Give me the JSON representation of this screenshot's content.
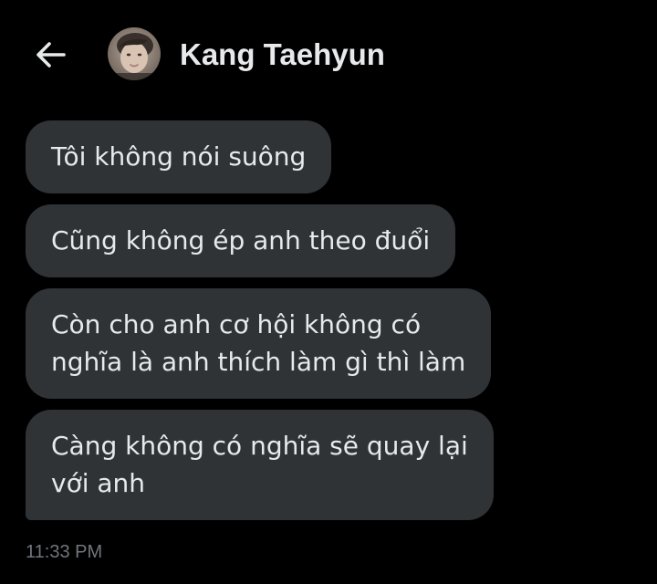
{
  "header": {
    "back_icon": "arrow-left-icon",
    "contact_name": "Kang Taehyun",
    "avatar_icon": "profile-photo"
  },
  "messages": [
    {
      "text": "Tôi không nói suông"
    },
    {
      "text": "Cũng không ép anh theo đuổi"
    },
    {
      "text": "Còn cho anh cơ hội không có\nnghĩa là anh thích làm gì thì làm"
    },
    {
      "text": "Càng không có nghĩa sẽ quay lại\nvới anh"
    }
  ],
  "timestamp": "11:33 PM",
  "colors": {
    "background": "#000000",
    "bubble": "#2f3336",
    "text": "#e7e9ea",
    "muted": "#71767b"
  }
}
